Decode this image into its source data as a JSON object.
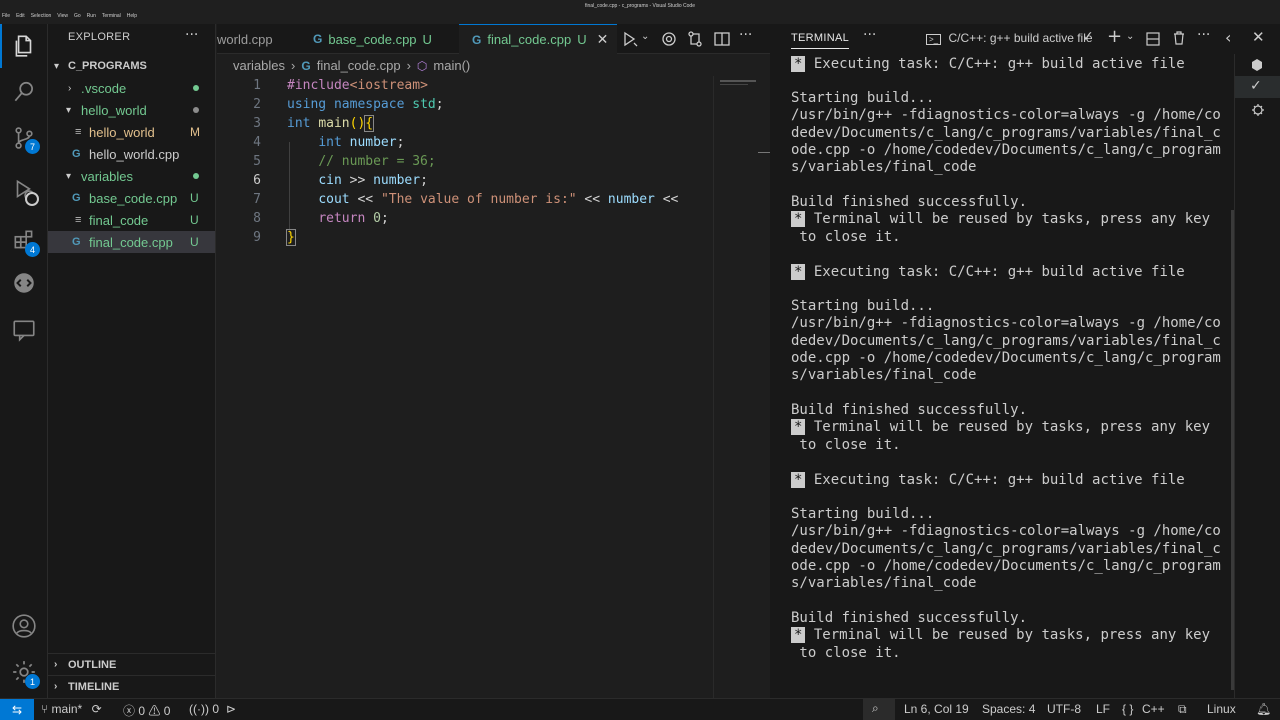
{
  "window": {
    "title": "final_code.cpp - c_programs - Visual Studio Code",
    "menu": [
      "File",
      "Edit",
      "Selection",
      "View",
      "Go",
      "Run",
      "Terminal",
      "Help"
    ]
  },
  "activity": {
    "scm_badge": "7",
    "extensions_badge": "4",
    "settings_badge": "1"
  },
  "explorer": {
    "header": "EXPLORER",
    "more": "···",
    "root": "C_PROGRAMS",
    "items": [
      {
        "label": "vscode",
        "prefix": ".",
        "status": "",
        "dot": "#73c991"
      },
      {
        "label": "hello_world",
        "status": "",
        "dot": "#73c991"
      },
      {
        "label": "hello_world",
        "status": "M"
      },
      {
        "label": "hello_world.cpp",
        "status": ""
      },
      {
        "label": "variables",
        "status": "",
        "dot": "#73c991"
      },
      {
        "label": "base_code.cpp",
        "status": "U"
      },
      {
        "label": "final_code",
        "status": "U"
      },
      {
        "label": "final_code.cpp",
        "status": "U"
      }
    ],
    "outline": "OUTLINE",
    "timeline": "TIMELINE"
  },
  "tabs": [
    {
      "label": "world.cpp",
      "status": ""
    },
    {
      "label": "base_code.cpp",
      "status": "U"
    },
    {
      "label": "final_code.cpp",
      "status": "U"
    }
  ],
  "breadcrumb": {
    "folder": "variables",
    "file": "final_code.cpp",
    "symbol": "main()"
  },
  "editor": {
    "current_line": 6,
    "line_numbers": [
      "1",
      "2",
      "3",
      "4",
      "5",
      "6",
      "7",
      "8",
      "9"
    ],
    "lines": {
      "l1_directive": "#include",
      "l1_header": "<iostream>",
      "l2_using": "using",
      "l2_namespace": "namespace",
      "l2_std": "std",
      "l2_semi": ";",
      "l3_int": "int",
      "l3_main": "main",
      "l3_paren": "()",
      "l3_brace": "{",
      "l4_int": "int",
      "l4_var": "number",
      "l4_semi": ";",
      "l5_comment": "// number = 36;",
      "l6_cin": "cin",
      "l6_op": " >> ",
      "l6_var": "number",
      "l6_semi": ";",
      "l7_cout": "cout",
      "l7_op1": " << ",
      "l7_str": "\"The value of number is:\"",
      "l7_op2": " << ",
      "l7_var": "number",
      "l7_op3": " <<",
      "l8_return": "return",
      "l8_num": "0",
      "l8_semi": ";",
      "l9_brace": "}"
    }
  },
  "terminal": {
    "title": "TERMINAL",
    "more": "···",
    "task_label": "C/C++: g++ build active file",
    "blocks": [
      {
        "exec": " Executing task: C/C++: g++ build active file",
        "starting": "Starting build...",
        "cmd": [
          "/usr/bin/g++ -fdiagnostics-color=always -g /home/co",
          "dedev/Documents/c_lang/c_programs/variables/final_c",
          "ode.cpp -o /home/codedev/Documents/c_lang/c_program",
          "s/variables/final_code"
        ],
        "finished": "Build finished successfully.",
        "reuse": " Terminal will be reused by tasks, press any key",
        "close": " to close it."
      },
      {
        "exec": " Executing task: C/C++: g++ build active file",
        "starting": "Starting build...",
        "cmd": [
          "/usr/bin/g++ -fdiagnostics-color=always -g /home/co",
          "dedev/Documents/c_lang/c_programs/variables/final_c",
          "ode.cpp -o /home/codedev/Documents/c_lang/c_program",
          "s/variables/final_code"
        ],
        "finished": "Build finished successfully.",
        "reuse": " Terminal will be reused by tasks, press any key",
        "close": " to close it."
      },
      {
        "exec": " Executing task: C/C++: g++ build active file",
        "starting": "Starting build...",
        "cmd": [
          "/usr/bin/g++ -fdiagnostics-color=always -g /home/co",
          "dedev/Documents/c_lang/c_programs/variables/final_c",
          "ode.cpp -o /home/codedev/Documents/c_lang/c_program",
          "s/variables/final_code"
        ],
        "finished": "Build finished successfully.",
        "reuse": " Terminal will be reused by tasks, press any key",
        "close": " to close it."
      }
    ],
    "star": "*"
  },
  "statusbar": {
    "branch": "main*",
    "errors": "0",
    "warnings": "0",
    "ports": "0",
    "position": "Ln 6, Col 19",
    "spaces": "Spaces: 4",
    "encoding": "UTF-8",
    "eol": "LF",
    "language": "C++",
    "platform": "Linux",
    "braces": "{ }"
  },
  "colors": {
    "accent": "#0078d4",
    "untracked": "#73c991",
    "modified": "#e2c08d"
  }
}
